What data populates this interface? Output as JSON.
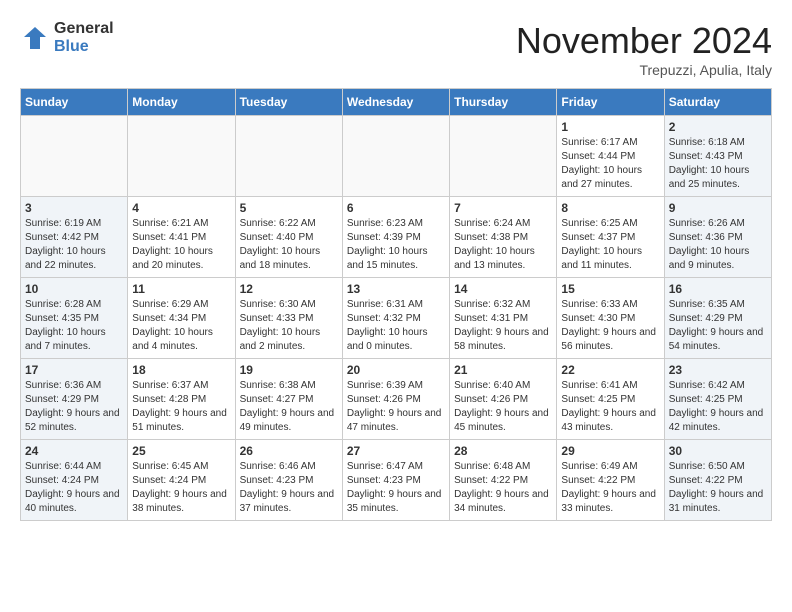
{
  "header": {
    "logo_general": "General",
    "logo_blue": "Blue",
    "month_title": "November 2024",
    "location": "Trepuzzi, Apulia, Italy"
  },
  "weekdays": [
    "Sunday",
    "Monday",
    "Tuesday",
    "Wednesday",
    "Thursday",
    "Friday",
    "Saturday"
  ],
  "weeks": [
    [
      {
        "day": "",
        "info": ""
      },
      {
        "day": "",
        "info": ""
      },
      {
        "day": "",
        "info": ""
      },
      {
        "day": "",
        "info": ""
      },
      {
        "day": "",
        "info": ""
      },
      {
        "day": "1",
        "info": "Sunrise: 6:17 AM\nSunset: 4:44 PM\nDaylight: 10 hours and 27 minutes."
      },
      {
        "day": "2",
        "info": "Sunrise: 6:18 AM\nSunset: 4:43 PM\nDaylight: 10 hours and 25 minutes."
      }
    ],
    [
      {
        "day": "3",
        "info": "Sunrise: 6:19 AM\nSunset: 4:42 PM\nDaylight: 10 hours and 22 minutes."
      },
      {
        "day": "4",
        "info": "Sunrise: 6:21 AM\nSunset: 4:41 PM\nDaylight: 10 hours and 20 minutes."
      },
      {
        "day": "5",
        "info": "Sunrise: 6:22 AM\nSunset: 4:40 PM\nDaylight: 10 hours and 18 minutes."
      },
      {
        "day": "6",
        "info": "Sunrise: 6:23 AM\nSunset: 4:39 PM\nDaylight: 10 hours and 15 minutes."
      },
      {
        "day": "7",
        "info": "Sunrise: 6:24 AM\nSunset: 4:38 PM\nDaylight: 10 hours and 13 minutes."
      },
      {
        "day": "8",
        "info": "Sunrise: 6:25 AM\nSunset: 4:37 PM\nDaylight: 10 hours and 11 minutes."
      },
      {
        "day": "9",
        "info": "Sunrise: 6:26 AM\nSunset: 4:36 PM\nDaylight: 10 hours and 9 minutes."
      }
    ],
    [
      {
        "day": "10",
        "info": "Sunrise: 6:28 AM\nSunset: 4:35 PM\nDaylight: 10 hours and 7 minutes."
      },
      {
        "day": "11",
        "info": "Sunrise: 6:29 AM\nSunset: 4:34 PM\nDaylight: 10 hours and 4 minutes."
      },
      {
        "day": "12",
        "info": "Sunrise: 6:30 AM\nSunset: 4:33 PM\nDaylight: 10 hours and 2 minutes."
      },
      {
        "day": "13",
        "info": "Sunrise: 6:31 AM\nSunset: 4:32 PM\nDaylight: 10 hours and 0 minutes."
      },
      {
        "day": "14",
        "info": "Sunrise: 6:32 AM\nSunset: 4:31 PM\nDaylight: 9 hours and 58 minutes."
      },
      {
        "day": "15",
        "info": "Sunrise: 6:33 AM\nSunset: 4:30 PM\nDaylight: 9 hours and 56 minutes."
      },
      {
        "day": "16",
        "info": "Sunrise: 6:35 AM\nSunset: 4:29 PM\nDaylight: 9 hours and 54 minutes."
      }
    ],
    [
      {
        "day": "17",
        "info": "Sunrise: 6:36 AM\nSunset: 4:29 PM\nDaylight: 9 hours and 52 minutes."
      },
      {
        "day": "18",
        "info": "Sunrise: 6:37 AM\nSunset: 4:28 PM\nDaylight: 9 hours and 51 minutes."
      },
      {
        "day": "19",
        "info": "Sunrise: 6:38 AM\nSunset: 4:27 PM\nDaylight: 9 hours and 49 minutes."
      },
      {
        "day": "20",
        "info": "Sunrise: 6:39 AM\nSunset: 4:26 PM\nDaylight: 9 hours and 47 minutes."
      },
      {
        "day": "21",
        "info": "Sunrise: 6:40 AM\nSunset: 4:26 PM\nDaylight: 9 hours and 45 minutes."
      },
      {
        "day": "22",
        "info": "Sunrise: 6:41 AM\nSunset: 4:25 PM\nDaylight: 9 hours and 43 minutes."
      },
      {
        "day": "23",
        "info": "Sunrise: 6:42 AM\nSunset: 4:25 PM\nDaylight: 9 hours and 42 minutes."
      }
    ],
    [
      {
        "day": "24",
        "info": "Sunrise: 6:44 AM\nSunset: 4:24 PM\nDaylight: 9 hours and 40 minutes."
      },
      {
        "day": "25",
        "info": "Sunrise: 6:45 AM\nSunset: 4:24 PM\nDaylight: 9 hours and 38 minutes."
      },
      {
        "day": "26",
        "info": "Sunrise: 6:46 AM\nSunset: 4:23 PM\nDaylight: 9 hours and 37 minutes."
      },
      {
        "day": "27",
        "info": "Sunrise: 6:47 AM\nSunset: 4:23 PM\nDaylight: 9 hours and 35 minutes."
      },
      {
        "day": "28",
        "info": "Sunrise: 6:48 AM\nSunset: 4:22 PM\nDaylight: 9 hours and 34 minutes."
      },
      {
        "day": "29",
        "info": "Sunrise: 6:49 AM\nSunset: 4:22 PM\nDaylight: 9 hours and 33 minutes."
      },
      {
        "day": "30",
        "info": "Sunrise: 6:50 AM\nSunset: 4:22 PM\nDaylight: 9 hours and 31 minutes."
      }
    ]
  ]
}
